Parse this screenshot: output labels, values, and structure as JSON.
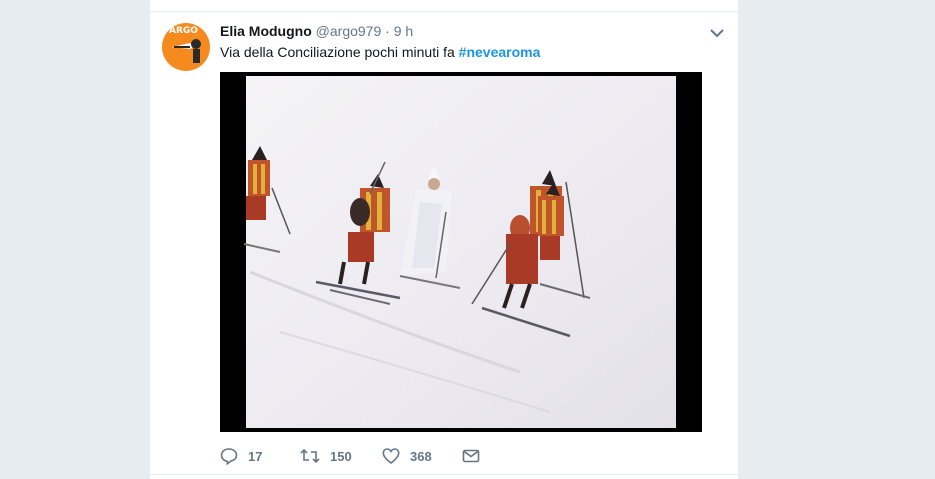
{
  "tweet": {
    "author_name": "Elia Modugno",
    "handle": "@argo979",
    "separator": "·",
    "time": "9 h",
    "text": "Via della Conciliazione pochi minuti fa ",
    "hashtag": "#nevearoma",
    "avatar_label": "ARGO",
    "caret_icon": "chevron-down-icon"
  },
  "actions": {
    "reply_count": "17",
    "retweet_count": "150",
    "like_count": "368"
  },
  "colors": {
    "accent": "#1b95e0",
    "avatar_bg": "#f58a1f",
    "muted": "#657786"
  }
}
